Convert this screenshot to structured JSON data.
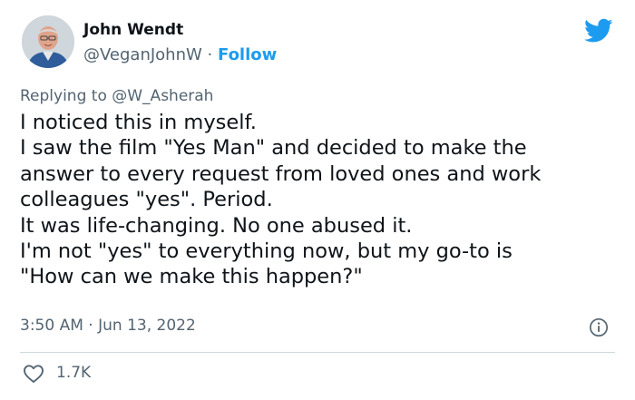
{
  "tweet": {
    "author_name": "John Wendt",
    "author_handle": "@VeganJohnW",
    "separator": "·",
    "follow_label": "Follow",
    "reply_prefix": "Replying to",
    "reply_to": "@W_Asherah",
    "lines": [
      "I noticed this in myself.",
      "I saw the film \"Yes Man\" and decided to make the",
      "answer to every request from loved ones and work",
      "colleagues \"yes\". Period.",
      "It was life-changing. No one abused it.",
      "I'm not \"yes\" to everything now, but my go-to is",
      "\"How can we make this happen?\""
    ],
    "time": "3:50 AM",
    "date": "Jun 13, 2022",
    "likes": "1.7K"
  },
  "icons": {
    "brand": "twitter-bird-icon",
    "info": "info-icon",
    "like": "heart-icon"
  },
  "colors": {
    "accent": "#1d9bf0",
    "text": "#0f1419",
    "muted": "#536471",
    "divider": "#cfd9de"
  }
}
